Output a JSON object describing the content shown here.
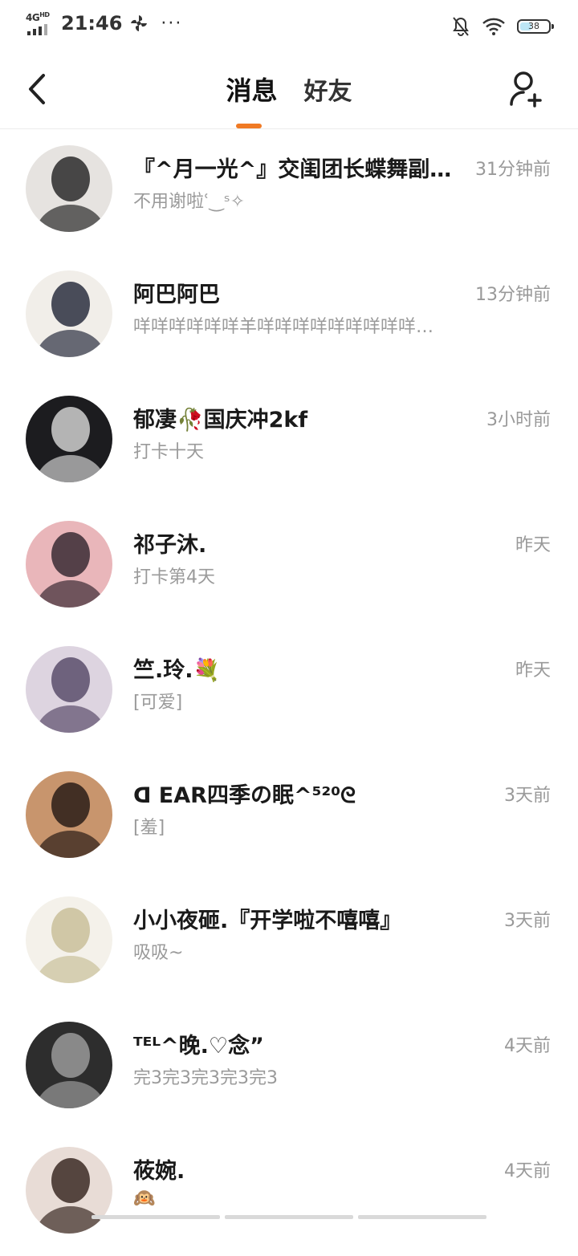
{
  "status_bar": {
    "network": "4G",
    "network_sup": "HD",
    "time": "21:46",
    "more": "···",
    "battery": "38"
  },
  "header": {
    "tabs": [
      {
        "label": "消息",
        "active": true
      },
      {
        "label": "好友",
        "active": false
      }
    ],
    "accent_color": "#f07a24",
    "back_icon": "chevron-left-icon",
    "add_icon": "add-friend-icon"
  },
  "conversations": [
    {
      "name": "『^月一光^』交闺团长蝶舞副…",
      "time": "31分钟前",
      "preview": "不用谢啦ʿ‿ˢ✧",
      "avatar_colors": [
        "#e6e3e0",
        "#2a2a2a"
      ]
    },
    {
      "name": "阿巴阿巴",
      "time": "13分钟前",
      "preview": "咩咩咩咩咩咩羊咩咩咩咩咩咩咩咩咩…",
      "avatar_colors": [
        "#f1eee9",
        "#2b2f40"
      ]
    },
    {
      "name": "郁凄🥀国庆冲2kf",
      "time": "3小时前",
      "preview": "打卡十天",
      "avatar_colors": [
        "#1c1c1f",
        "#cfcfcf"
      ]
    },
    {
      "name": "祁子沐.",
      "time": "昨天",
      "preview": "打卡第4天",
      "avatar_colors": [
        "#e9b6ba",
        "#3a2b34"
      ]
    },
    {
      "name": "竺.玲.💐",
      "time": "昨天",
      "preview": "[可爱]",
      "avatar_colors": [
        "#ddd4e0",
        "#5b4d6b"
      ]
    },
    {
      "name": "ᗡ EAR四季の眠^⁵²⁰ᘓ",
      "time": "3天前",
      "preview": "[羞]",
      "avatar_colors": [
        "#c8956d",
        "#2a1d17"
      ]
    },
    {
      "name": "小小夜砸.『开学啦不嘻嘻』",
      "time": "3天前",
      "preview": "吸吸~",
      "avatar_colors": [
        "#f4f1ea",
        "#c9c09a"
      ]
    },
    {
      "name": "ᵀᴱᴸ^晚.♡念”",
      "time": "4天前",
      "preview": "完3完3完3完3完3",
      "avatar_colors": [
        "#2d2d2d",
        "#9a9a9a"
      ]
    },
    {
      "name": "莜婉.",
      "time": "4天前",
      "preview": "🙉",
      "avatar_colors": [
        "#e8dcd6",
        "#3b2a24"
      ]
    }
  ]
}
